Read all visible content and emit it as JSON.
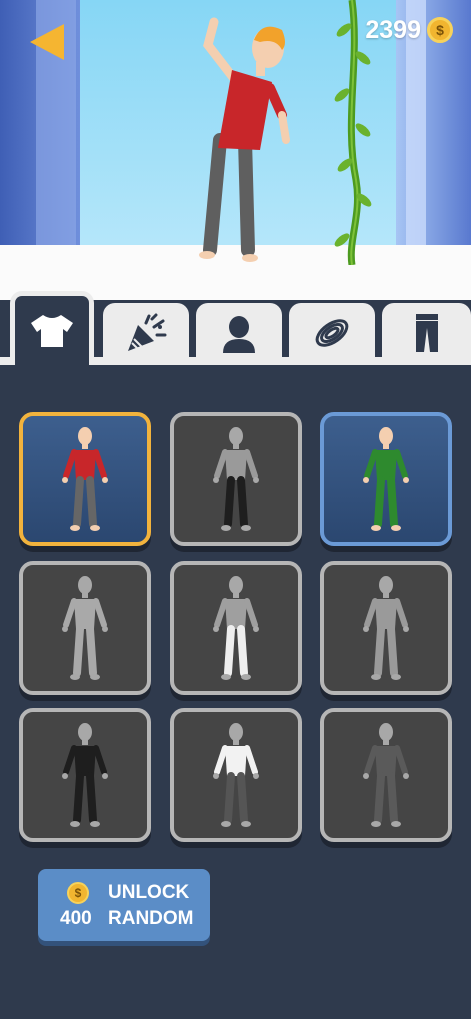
{
  "coins": {
    "amount": "2399",
    "symbol": "$"
  },
  "tabs": [
    {
      "name": "tab-shirts",
      "active": true
    },
    {
      "name": "tab-celebration",
      "active": false
    },
    {
      "name": "tab-head",
      "active": false
    },
    {
      "name": "tab-rope",
      "active": false
    },
    {
      "name": "tab-pants",
      "active": false
    }
  ],
  "outfits": [
    {
      "state": "selected",
      "shirt": "#c8262a",
      "pants": "#666666"
    },
    {
      "state": "locked",
      "shirt": "#9a9a9a",
      "pants": "#1e1e1e"
    },
    {
      "state": "owned",
      "shirt": "#2e8a2e",
      "pants": "#2e8a2e"
    },
    {
      "state": "locked",
      "shirt": "#a9a9a9",
      "pants": "#a9a9a9"
    },
    {
      "state": "locked",
      "shirt": "#9f9f9f",
      "pants": "#eeeeee"
    },
    {
      "state": "locked",
      "shirt": "#9a9a9a",
      "pants": "#9a9a9a"
    },
    {
      "state": "locked",
      "shirt": "#1e1e1e",
      "pants": "#1e1e1e"
    },
    {
      "state": "locked",
      "shirt": "#f2f2f2",
      "pants": "#555555"
    },
    {
      "state": "locked",
      "shirt": "#5a5a5a",
      "pants": "#5a5a5a"
    }
  ],
  "unlock": {
    "price": "400",
    "label_top": "UNLOCK",
    "label_bottom": "RANDOM",
    "coin_symbol": "$"
  },
  "colors": {
    "accent": "#f2b33d",
    "button": "#5b8dc7",
    "panel": "#2f3a4d"
  }
}
